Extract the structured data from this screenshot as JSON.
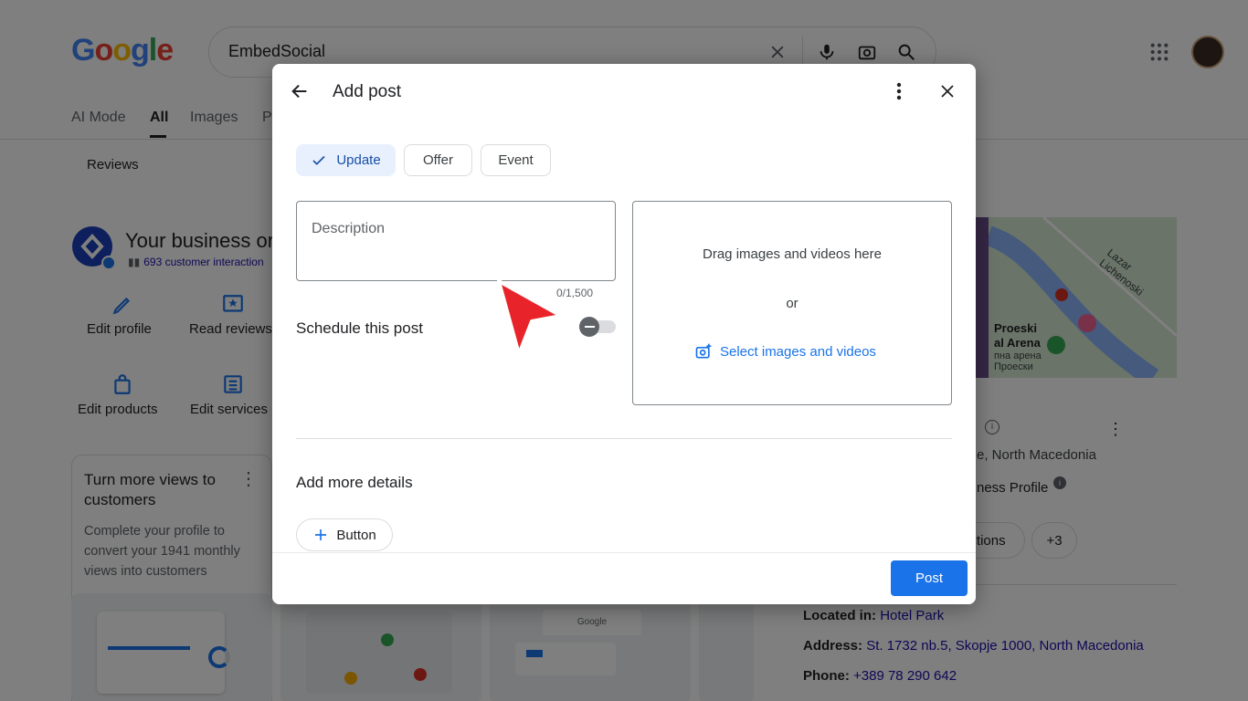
{
  "google": {
    "logo": "Google",
    "search_value": "EmbedSocial",
    "nav_tabs": [
      "AI Mode",
      "All",
      "Images",
      "P"
    ],
    "reviews_tab": "Reviews",
    "business_title": "Your business or",
    "business_sub": "693 customer interaction",
    "actions": [
      "Edit profile",
      "Read reviews",
      "Edit products",
      "Edit services"
    ],
    "card": {
      "title": "Turn more views to customers",
      "text": "Complete your profile to convert your 1941 monthly views into customers"
    },
    "thumb_logo": "Google",
    "map_labels": [
      "Lazar Lichenoski",
      "Proeski",
      "al Arena",
      "пна арена",
      "Проески"
    ],
    "right_panel": {
      "location_tail": "e, North Macedonia",
      "profile_tail": "ness Profile",
      "pill_actions": "ctions",
      "pill_more": "+3",
      "located_label": "Located in:",
      "located_value": "Hotel Park",
      "address_label": "Address:",
      "address_value": "St. 1732 nb.5, Skopje 1000, North Macedonia",
      "phone_label": "Phone:",
      "phone_value": "+389 78 290 642"
    }
  },
  "dialog": {
    "title": "Add post",
    "chips": [
      "Update",
      "Offer",
      "Event"
    ],
    "description_placeholder": "Description",
    "counter": "0/1,500",
    "schedule_label": "Schedule this post",
    "schedule_on": false,
    "drop_text": "Drag images and videos here",
    "drop_or": "or",
    "select_media": "Select images and videos",
    "more_details": "Add more details",
    "button_label": "Button",
    "post_label": "Post"
  },
  "colors": {
    "accent": "#1a73e8",
    "overlay": "rgba(0,0,0,0.5)",
    "cursor": "#e8232a"
  }
}
